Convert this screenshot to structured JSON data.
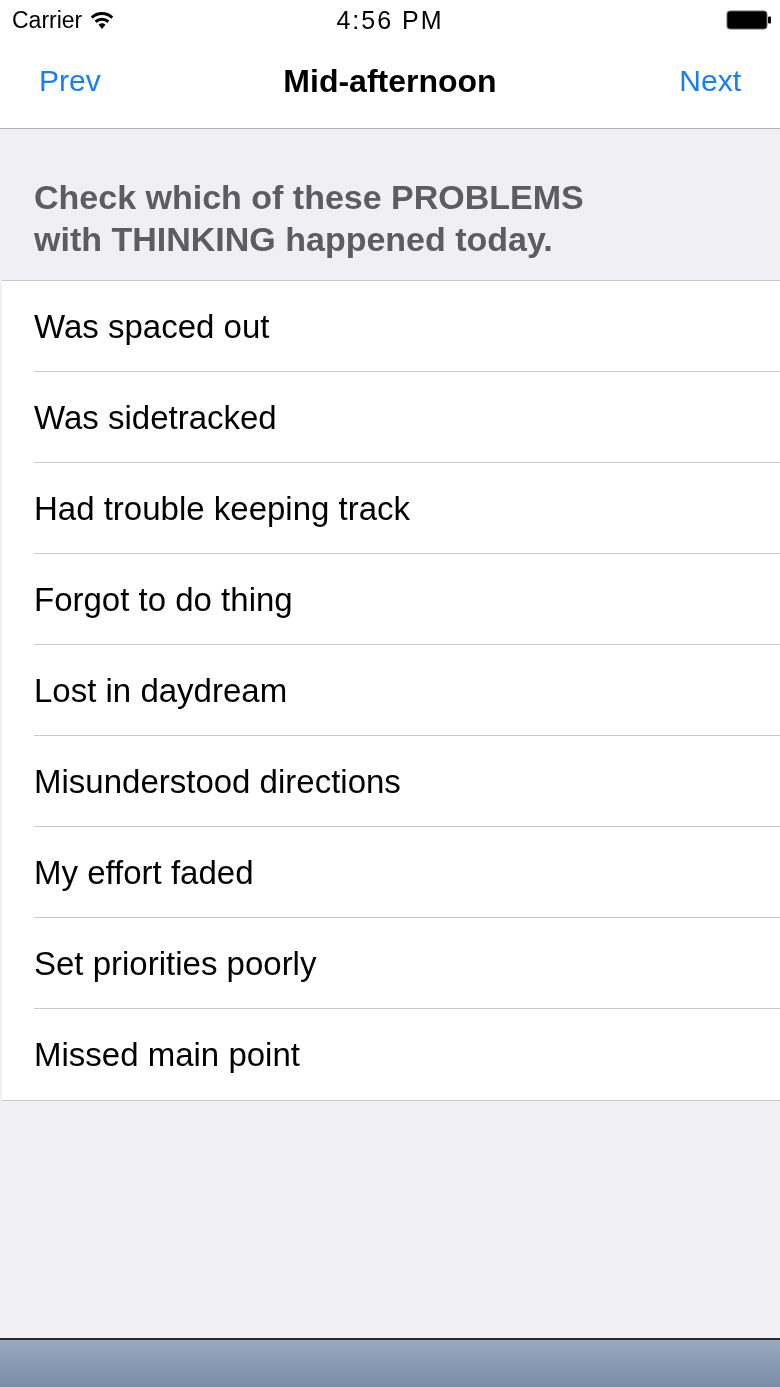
{
  "status_bar": {
    "carrier": "Carrier",
    "time": "4:56 PM"
  },
  "nav_bar": {
    "back": "Prev",
    "title": "Mid-afternoon",
    "forward": "Next"
  },
  "section_header": "Check which of these PROBLEMS with THINKING happened today.",
  "items": [
    {
      "label": "Was spaced out"
    },
    {
      "label": "Was sidetracked"
    },
    {
      "label": "Had trouble keeping track"
    },
    {
      "label": "Forgot to do thing"
    },
    {
      "label": "Lost in daydream"
    },
    {
      "label": "Misunderstood directions"
    },
    {
      "label": "My effort faded"
    },
    {
      "label": "Set priorities poorly"
    },
    {
      "label": "Missed main point"
    }
  ]
}
